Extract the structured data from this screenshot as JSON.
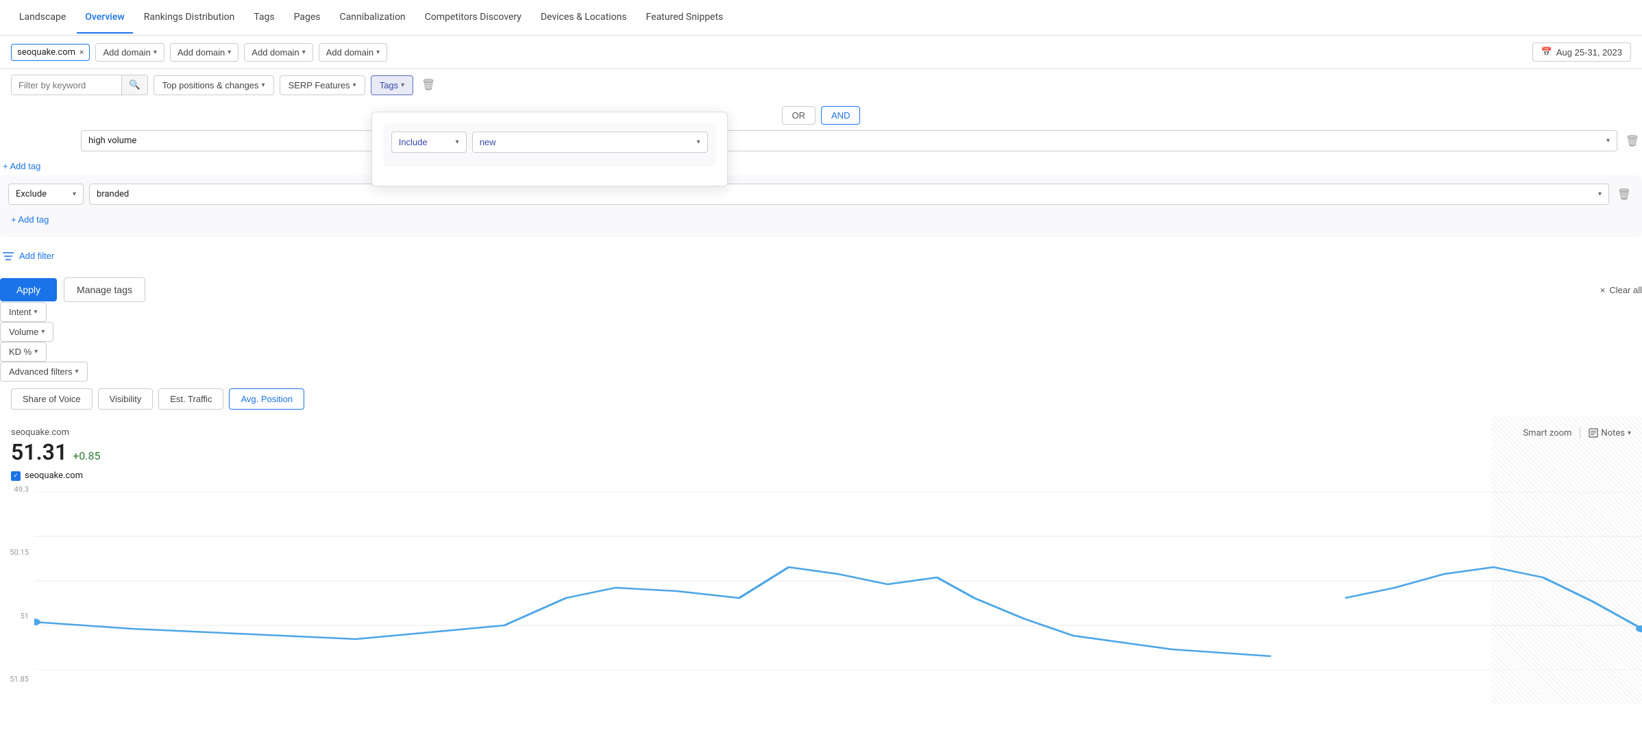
{
  "nav": {
    "items": [
      {
        "label": "Landscape",
        "active": false
      },
      {
        "label": "Overview",
        "active": true
      },
      {
        "label": "Rankings Distribution",
        "active": false
      },
      {
        "label": "Tags",
        "active": false
      },
      {
        "label": "Pages",
        "active": false
      },
      {
        "label": "Cannibalization",
        "active": false
      },
      {
        "label": "Competitors Discovery",
        "active": false
      },
      {
        "label": "Devices & Locations",
        "active": false
      },
      {
        "label": "Featured Snippets",
        "active": false
      }
    ]
  },
  "toolbar": {
    "domain": "seoquake.com",
    "close_label": "×",
    "add_domain_label": "Add domain",
    "date_icon": "📅",
    "date_label": "Aug 25-31, 2023"
  },
  "filterbar": {
    "keyword_placeholder": "Filter by keyword",
    "search_icon": "🔍",
    "filters": [
      {
        "label": "Top positions & changes",
        "active": false
      },
      {
        "label": "SERP Features",
        "active": false
      },
      {
        "label": "Tags",
        "active": true
      },
      {
        "label": "Intent",
        "active": false
      },
      {
        "label": "Volume",
        "active": false
      },
      {
        "label": "KD %",
        "active": false
      },
      {
        "label": "Advanced filters",
        "active": false
      }
    ]
  },
  "metric_tabs": [
    {
      "label": "Share of Voice",
      "active": false
    },
    {
      "label": "Visibility",
      "active": false
    },
    {
      "label": "Est. Traffic",
      "active": false
    },
    {
      "label": "Avg. Position",
      "active": true
    }
  ],
  "chart": {
    "domain_label": "seoquake.com",
    "value": "51.31",
    "delta": "+0.85",
    "legend_domain": "seoquake.com",
    "y_labels": [
      "49.3",
      "50.15",
      "51",
      "51.85"
    ],
    "smart_zoom": "Smart zoom",
    "notes": "Notes"
  },
  "tags_popup": {
    "section1": {
      "include_label": "Include",
      "tag_value": "new",
      "or_label": "OR",
      "and_label": "AND",
      "tag2_value": "high volume",
      "add_tag_label": "+ Add tag"
    },
    "section2": {
      "exclude_label": "Exclude",
      "tag_value": "branded",
      "add_tag_label": "+ Add tag"
    },
    "add_filter_label": "Add filter",
    "footer": {
      "apply_label": "Apply",
      "manage_tags_label": "Manage tags",
      "clear_all_prefix": "×",
      "clear_all_label": "Clear all"
    }
  }
}
